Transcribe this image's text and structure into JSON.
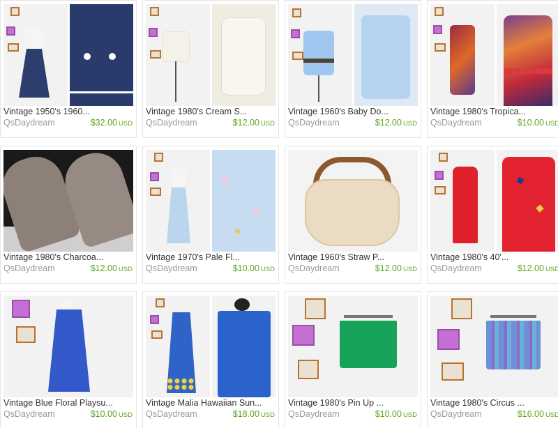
{
  "listings": [
    {
      "title": "Vintage 1950's 1960...",
      "shop": "QsDaydream",
      "price": "$32.00",
      "currency": "USD",
      "colors": [
        "#2d3d6e",
        "#2a3a6a"
      ]
    },
    {
      "title": "Vintage 1980's Cream S...",
      "shop": "QsDaydream",
      "price": "$12.00",
      "currency": "USD",
      "colors": [
        "#f4f1e8",
        "#efece2"
      ]
    },
    {
      "title": "Vintage 1960's Baby Do...",
      "shop": "QsDaydream",
      "price": "$12.00",
      "currency": "USD",
      "colors": [
        "#9ec6ee",
        "#b4d3f0"
      ]
    },
    {
      "title": "Vintage 1980's Tropica...",
      "shop": "QsDaydream",
      "price": "$10.00",
      "currency": "USD",
      "colors": [
        "#9a2d3e",
        "#7b3f8c"
      ]
    },
    {
      "title": "Vintage 1980's Charcoa...",
      "shop": "QsDaydream",
      "price": "$12.00",
      "currency": "USD",
      "colors": [
        "#8d8079"
      ]
    },
    {
      "title": "Vintage 1970's Pale Fl...",
      "shop": "QsDaydream",
      "price": "$10.00",
      "currency": "USD",
      "colors": [
        "#b9d6ee",
        "#c8dcf1"
      ]
    },
    {
      "title": "Vintage 1960's Straw P...",
      "shop": "QsDaydream",
      "price": "$12.00",
      "currency": "USD",
      "colors": [
        "#e9dcc2"
      ]
    },
    {
      "title": "Vintage 1980's 40'...",
      "shop": "QsDaydream",
      "price": "$12.00",
      "currency": "USD",
      "colors": [
        "#e0202c",
        "#e3232f"
      ]
    },
    {
      "title": "Vintage Blue Floral Playsu...",
      "shop": "QsDaydream",
      "price": "$10.00",
      "currency": "USD",
      "colors": [
        "#3358c9"
      ]
    },
    {
      "title": "Vintage Malia Hawaiian Sun...",
      "shop": "QsDaydream",
      "price": "$18.00",
      "currency": "USD",
      "colors": [
        "#2f63c8",
        "#2c62cc"
      ]
    },
    {
      "title": "Vintage 1980's Pin Up ...",
      "shop": "QsDaydream",
      "price": "$10.00",
      "currency": "USD",
      "colors": [
        "#17a35a"
      ]
    },
    {
      "title": "Vintage 1980's Circus ...",
      "shop": "QsDaydream",
      "price": "$16.00",
      "currency": "USD",
      "colors": [
        "#6f8fd6"
      ]
    }
  ]
}
